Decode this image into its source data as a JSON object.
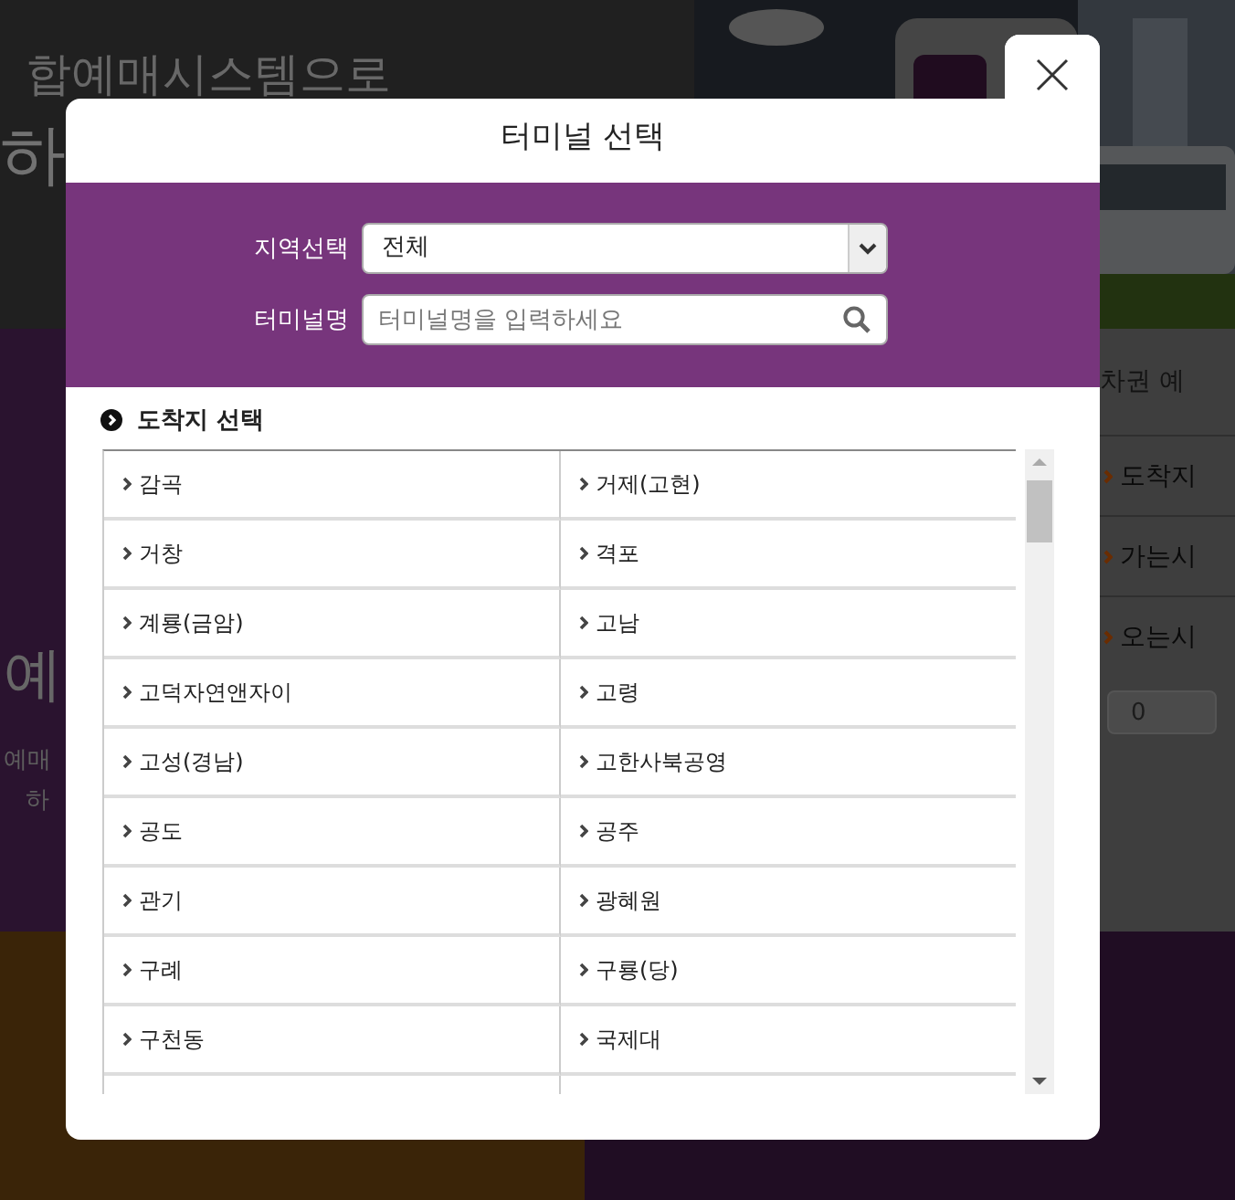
{
  "background": {
    "headline": "합예매시스템으로",
    "headline_2": "하",
    "tab_label": "차권 예",
    "side_title": "예",
    "side_text": [
      "예매",
      "하"
    ],
    "side_rows": [
      "도착지",
      "가는시",
      "오는시"
    ],
    "count_select": "0"
  },
  "dialog": {
    "title": "터미널 선택",
    "region_label": "지역선택",
    "region_value": "전체",
    "name_label": "터미널명",
    "name_placeholder": "터미널명을 입력하세요",
    "section_title": "도착지 선택",
    "terminals": [
      "감곡",
      "거제(고현)",
      "거창",
      "격포",
      "계룡(금암)",
      "고남",
      "고덕자연앤자이",
      "고령",
      "고성(경남)",
      "고한사북공영",
      "공도",
      "공주",
      "관기",
      "광혜원",
      "구례",
      "구룡(당)",
      "구천동",
      "국제대"
    ]
  }
}
